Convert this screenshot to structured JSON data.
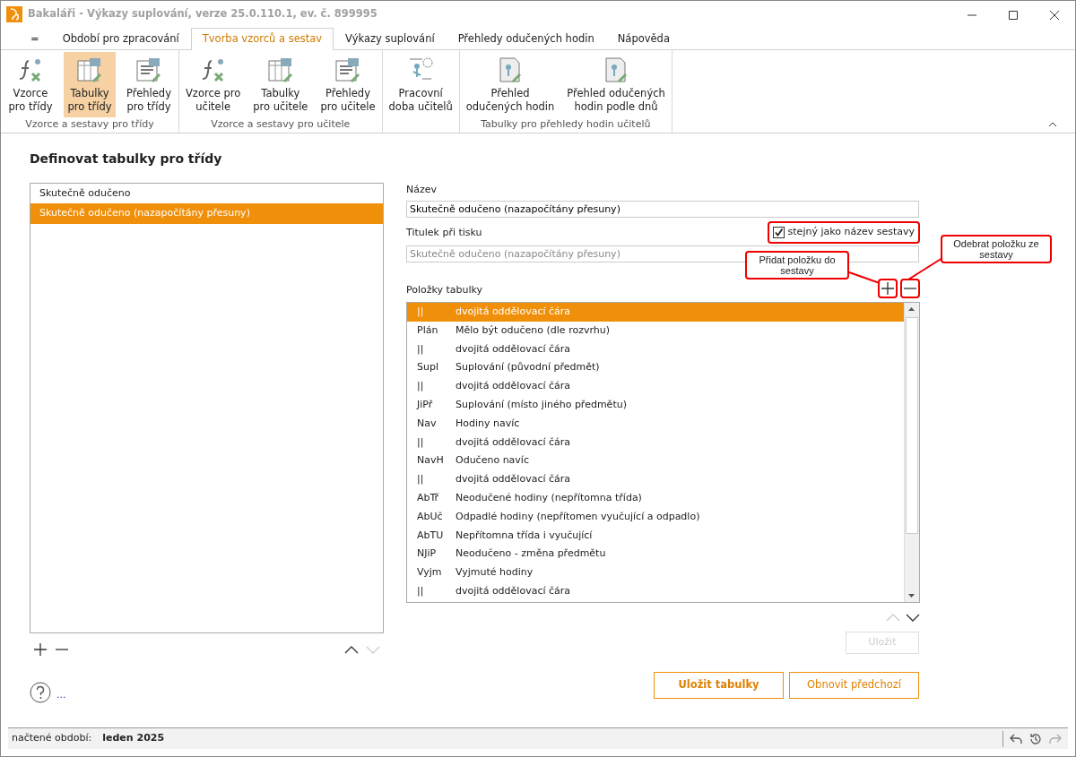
{
  "window": {
    "title": "Bakaláři - Výkazy suplování, verze 25.0.110.1, ev. č. 899995"
  },
  "menu_tabs": [
    {
      "label": "=",
      "selected": false
    },
    {
      "label": "Období pro zpracování",
      "selected": false
    },
    {
      "label": "Tvorba vzorců a sestav",
      "selected": true
    },
    {
      "label": "Výkazy suplování",
      "selected": false
    },
    {
      "label": "Přehledy odučených hodin",
      "selected": false
    },
    {
      "label": "Nápověda",
      "selected": false
    }
  ],
  "ribbon_groups": [
    {
      "label": "Vzorce a sestavy pro třídy",
      "buttons": [
        {
          "label": "Vzorce\npro třídy",
          "selected": false
        },
        {
          "label": "Tabulky\npro třídy",
          "selected": true
        },
        {
          "label": "Přehledy\npro třídy",
          "selected": false
        }
      ]
    },
    {
      "label": "Vzorce a sestavy pro učitele",
      "buttons": [
        {
          "label": "Vzorce pro\nučitele",
          "selected": false
        },
        {
          "label": "Tabulky\npro učitele",
          "selected": false
        },
        {
          "label": "Přehledy\npro učitele",
          "selected": false
        }
      ]
    },
    {
      "buttons": [
        {
          "label": "Pracovní\ndoba učitelů",
          "selected": false
        }
      ]
    },
    {
      "label": "Tabulky pro přehledy hodin učitelů",
      "buttons": [
        {
          "label": "Přehled\nodučených hodin",
          "selected": false
        },
        {
          "label": "Přehled odučených\nhodin podle dnů",
          "selected": false
        }
      ]
    }
  ],
  "page_title": "Definovat tabulky pro třídy",
  "tables": [
    {
      "label": "Skutečně odučeno",
      "selected": false
    },
    {
      "label": "Skutečně odučeno (nazapočítány přesuny)",
      "selected": true
    }
  ],
  "form": {
    "name_label": "Název",
    "name_value": "Skutečně odučeno (nazapočítány přesuny)",
    "print_title_label": "Titulek při tisku",
    "same_as_name": {
      "label": "stejný jako název sestavy",
      "checked": true
    },
    "print_title_value": "Skutečně odučeno (nazapočítány přesuny)",
    "print_title_disabled": true,
    "items_label": "Položky tabulky"
  },
  "items": [
    {
      "code": "||",
      "description": "dvojitá oddělovací čára",
      "selected": true
    },
    {
      "code": "Plán",
      "description": "Mělo být odučeno (dle rozvrhu)",
      "selected": false
    },
    {
      "code": "||",
      "description": "dvojitá oddělovací čára",
      "selected": false
    },
    {
      "code": "Supl",
      "description": "Suplování (původní předmět)",
      "selected": false
    },
    {
      "code": "||",
      "description": "dvojitá oddělovací čára",
      "selected": false
    },
    {
      "code": "JiPř",
      "description": "Suplování (místo jiného předmětu)",
      "selected": false
    },
    {
      "code": "Nav",
      "description": "Hodiny navíc",
      "selected": false
    },
    {
      "code": "||",
      "description": "dvojitá oddělovací čára",
      "selected": false
    },
    {
      "code": "NavH",
      "description": "Odučeno navíc",
      "selected": false
    },
    {
      "code": "||",
      "description": "dvojitá oddělovací čára",
      "selected": false
    },
    {
      "code": "AbTř",
      "description": "Neodučené hodiny (nepřítomna třída)",
      "selected": false
    },
    {
      "code": "AbUč",
      "description": "Odpadlé hodiny (nepřítomen vyučující a odpadlo)",
      "selected": false
    },
    {
      "code": "AbTU",
      "description": "Nepřítomna třída i vyučující",
      "selected": false
    },
    {
      "code": "NJiP",
      "description": "Neodučeno - změna předmětu",
      "selected": false
    },
    {
      "code": "Vyjm",
      "description": "Vyjmuté hodiny",
      "selected": false
    },
    {
      "code": "||",
      "description": "dvojitá oddělovací čára",
      "selected": false
    }
  ],
  "callouts": [
    {
      "text": "Přidat položku do sestavy"
    },
    {
      "text": "Odebrat položku ze sestavy"
    }
  ],
  "save_button": {
    "label": "Uložit",
    "disabled": true
  },
  "save_tables_button": "Uložit tabulky",
  "restore_button": "Obnovit předchozí",
  "help_more": "...",
  "status_bar": {
    "label": "načtené období:",
    "value": "leden 2025"
  }
}
